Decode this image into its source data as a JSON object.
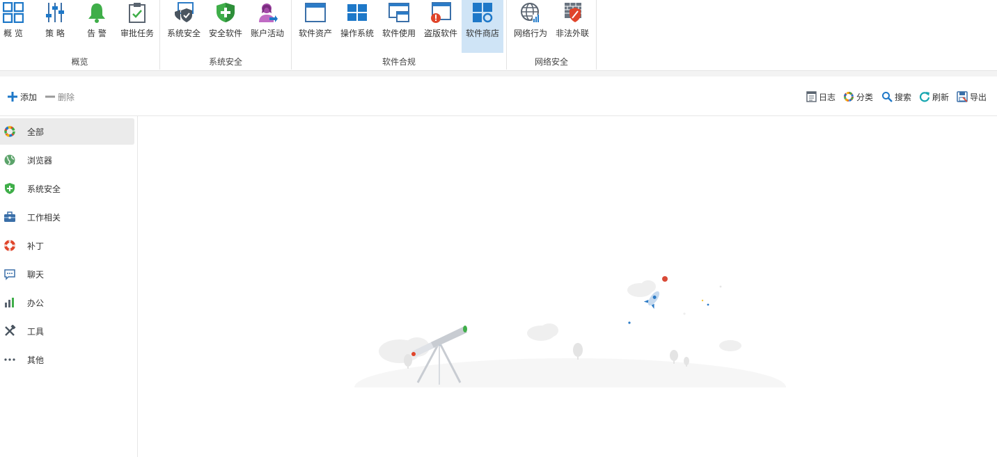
{
  "ribbon": {
    "groups": [
      {
        "label": "概览",
        "buttons": [
          {
            "label": "概 览",
            "icon": "overview-grid-icon"
          },
          {
            "label": "策 略",
            "icon": "policy-sliders-icon"
          },
          {
            "label": "告 警",
            "icon": "alarm-bell-icon"
          },
          {
            "label": "审批任务",
            "icon": "approval-clipboard-icon"
          }
        ]
      },
      {
        "label": "系统安全",
        "buttons": [
          {
            "label": "系统安全",
            "icon": "system-security-icon"
          },
          {
            "label": "安全软件",
            "icon": "security-software-shield-icon"
          },
          {
            "label": "账户活动",
            "icon": "account-activity-icon"
          }
        ]
      },
      {
        "label": "软件合规",
        "buttons": [
          {
            "label": "软件资产",
            "icon": "software-assets-icon"
          },
          {
            "label": "操作系统",
            "icon": "windows-os-icon"
          },
          {
            "label": "软件使用",
            "icon": "software-usage-icon"
          },
          {
            "label": "盗版软件",
            "icon": "pirated-software-icon"
          },
          {
            "label": "软件商店",
            "icon": "software-store-icon",
            "active": true
          }
        ]
      },
      {
        "label": "网络安全",
        "buttons": [
          {
            "label": "网络行为",
            "icon": "network-behavior-globe-icon"
          },
          {
            "label": "非法外联",
            "icon": "illegal-outreach-firewall-icon"
          }
        ]
      }
    ]
  },
  "toolbar": {
    "add": "添加",
    "delete": "删除",
    "log": "日志",
    "category": "分类",
    "search": "搜索",
    "refresh": "刷新",
    "export": "导出"
  },
  "sidebar": {
    "items": [
      {
        "label": "全部",
        "icon": "all-categories-icon",
        "active": true
      },
      {
        "label": "浏览器",
        "icon": "browser-globe-icon"
      },
      {
        "label": "系统安全",
        "icon": "system-security-shield-icon"
      },
      {
        "label": "工作相关",
        "icon": "briefcase-icon"
      },
      {
        "label": "补丁",
        "icon": "lifebuoy-icon"
      },
      {
        "label": "聊天",
        "icon": "chat-bubble-icon"
      },
      {
        "label": "办公",
        "icon": "office-chart-icon"
      },
      {
        "label": "工具",
        "icon": "tools-icon"
      },
      {
        "label": "其他",
        "icon": "more-dots-icon"
      }
    ]
  },
  "colors": {
    "accent": "#1e78c8",
    "active_tab": "#cfe4f6",
    "sidebar_active": "#ebebeb",
    "alarm_green": "#3fae49",
    "warn_red": "#e0452b"
  }
}
